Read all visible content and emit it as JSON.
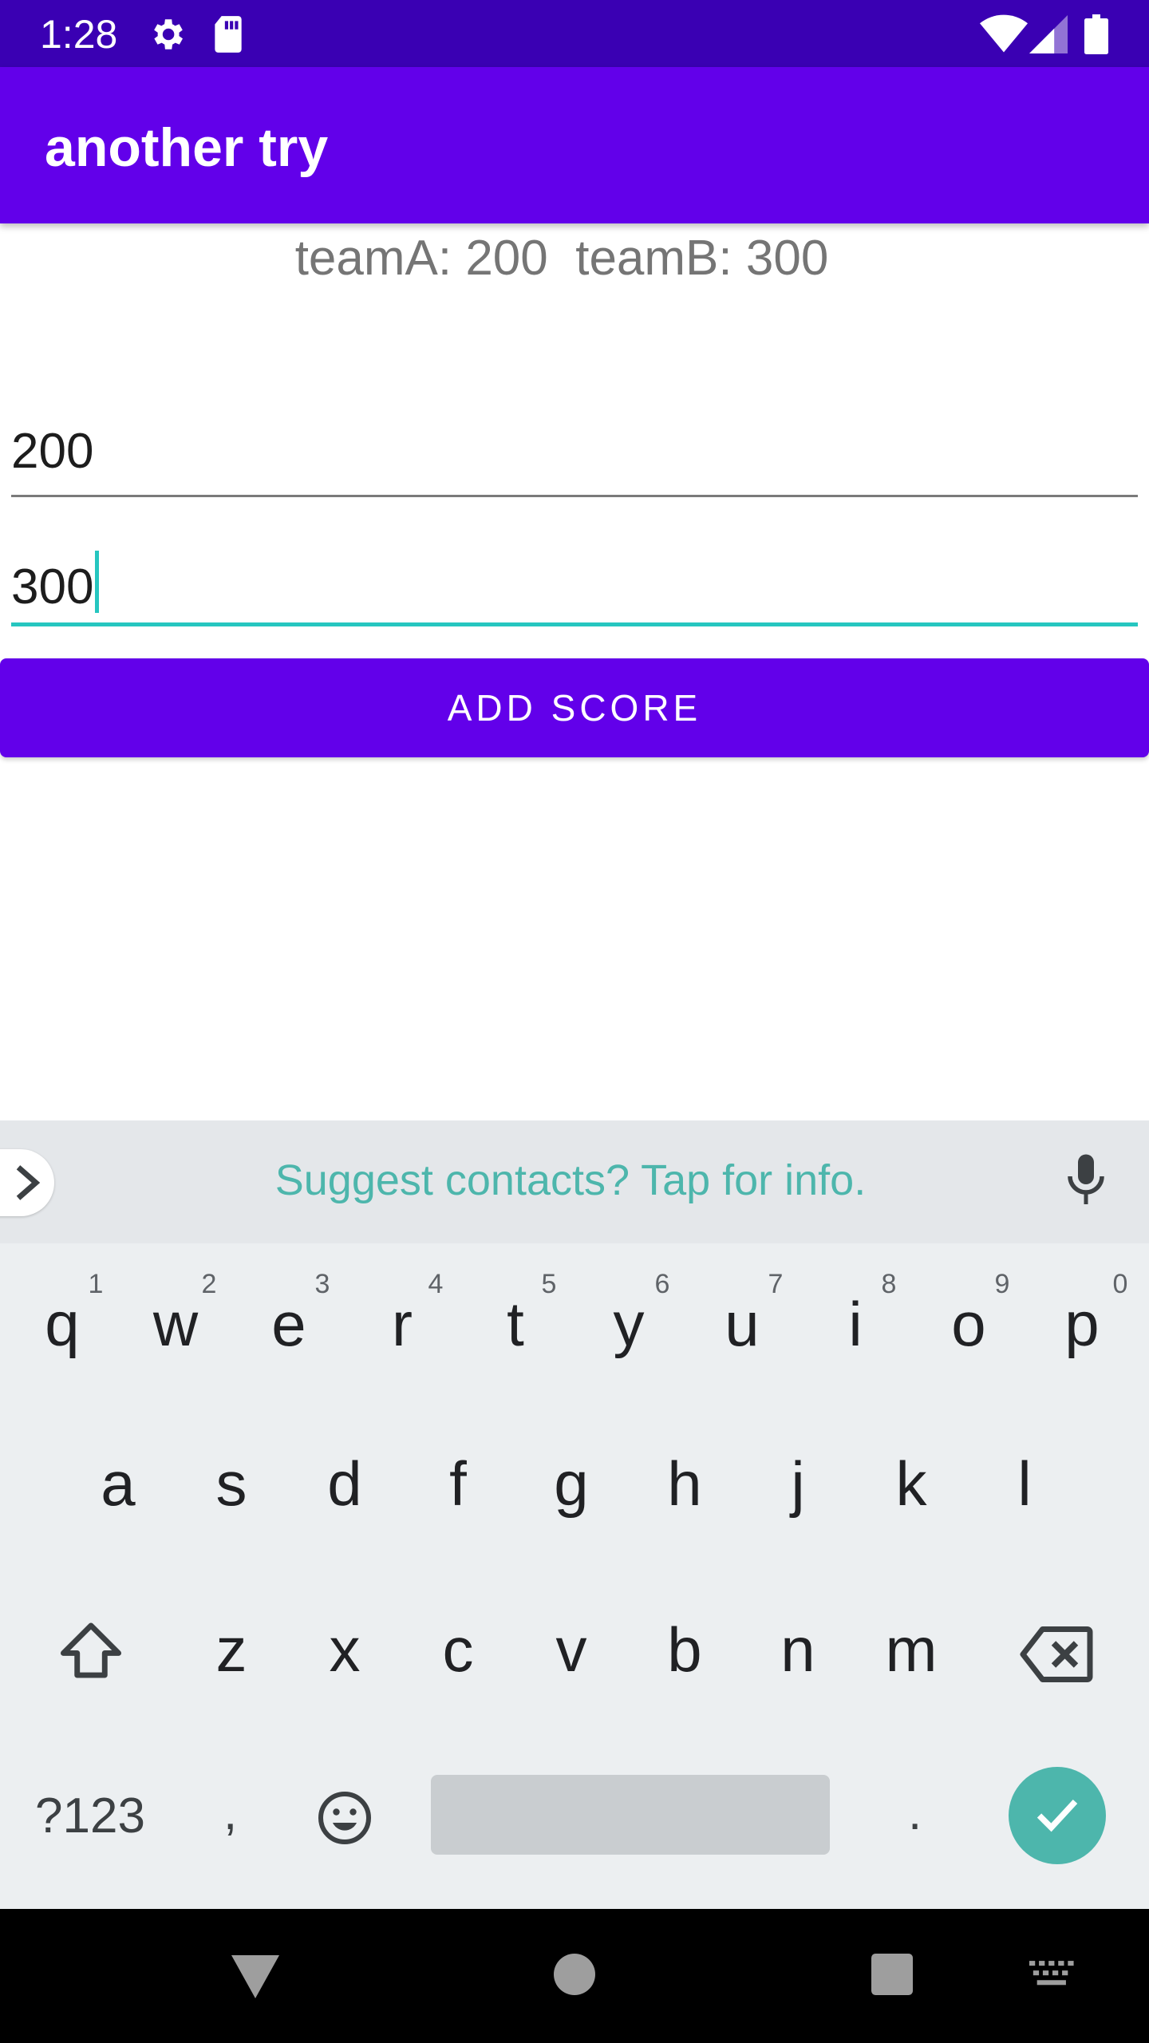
{
  "status_bar": {
    "time": "1:28"
  },
  "app_bar": {
    "title": "another try"
  },
  "score_display": "teamA: 200  teamB: 300",
  "fields": {
    "team_a_value": "200",
    "team_b_value": "300"
  },
  "add_button_label": "ADD SCORE",
  "keyboard": {
    "suggestion": "Suggest contacts? Tap for info.",
    "row1": [
      "q",
      "w",
      "e",
      "r",
      "t",
      "y",
      "u",
      "i",
      "o",
      "p"
    ],
    "row1_hints": [
      "1",
      "2",
      "3",
      "4",
      "5",
      "6",
      "7",
      "8",
      "9",
      "0"
    ],
    "row2": [
      "a",
      "s",
      "d",
      "f",
      "g",
      "h",
      "j",
      "k",
      "l"
    ],
    "row3": [
      "z",
      "x",
      "c",
      "v",
      "b",
      "n",
      "m"
    ],
    "symbols_label": "?123",
    "comma": ",",
    "period": "."
  },
  "colors": {
    "status_bar": "#3a00b3",
    "primary": "#6200ea",
    "accent": "#26c6c0",
    "keyboard_accent": "#4db6ac"
  }
}
